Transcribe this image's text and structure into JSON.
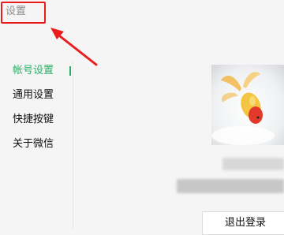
{
  "window": {
    "title": "设置"
  },
  "nav": {
    "items": [
      {
        "label": "帐号设置",
        "active": true
      },
      {
        "label": "通用设置"
      },
      {
        "label": "快捷按键"
      },
      {
        "label": "关于微信"
      }
    ]
  },
  "account": {
    "logout_label": "退出登录"
  },
  "colors": {
    "accent": "#2aae67",
    "highlight": "#ea1d1d"
  }
}
